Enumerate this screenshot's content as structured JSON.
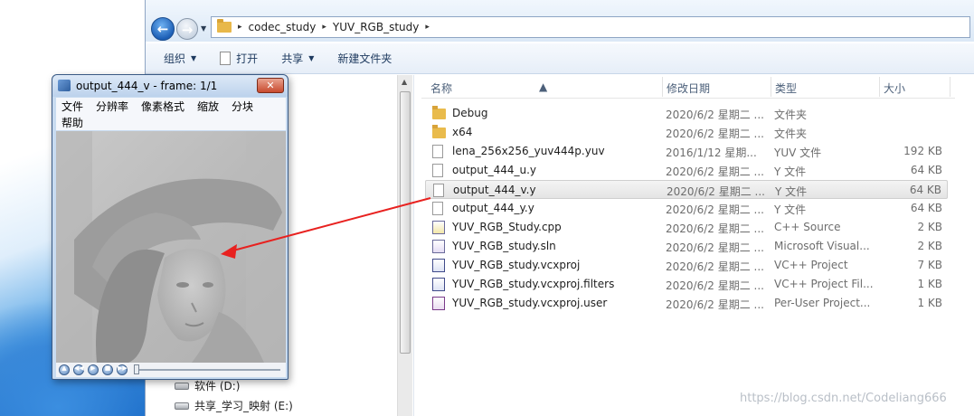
{
  "address": {
    "crumbs": [
      "codec_study",
      "YUV_RGB_study"
    ]
  },
  "toolbar": {
    "organize_label": "组织",
    "open_label": "打开",
    "share_label": "共享",
    "new_folder_label": "新建文件夹"
  },
  "leftpane": {
    "drives": [
      {
        "label": "软件 (D:)"
      },
      {
        "label": "共享_学习_映射 (E:)"
      }
    ]
  },
  "columns": {
    "name": "名称",
    "date": "修改日期",
    "type": "类型",
    "size": "大小"
  },
  "files": [
    {
      "name": "Debug",
      "date": "2020/6/2 星期二 ...",
      "type": "文件夹",
      "size": "",
      "icon": "folder-icon"
    },
    {
      "name": "x64",
      "date": "2020/6/2 星期二 ...",
      "type": "文件夹",
      "size": "",
      "icon": "folder-icon"
    },
    {
      "name": "lena_256x256_yuv444p.yuv",
      "date": "2016/1/12 星期...",
      "type": "YUV 文件",
      "size": "192 KB",
      "icon": "file-icon"
    },
    {
      "name": "output_444_u.y",
      "date": "2020/6/2 星期二 ...",
      "type": "Y 文件",
      "size": "64 KB",
      "icon": "file-icon"
    },
    {
      "name": "output_444_v.y",
      "date": "2020/6/2 星期二 ...",
      "type": "Y 文件",
      "size": "64 KB",
      "icon": "file-icon"
    },
    {
      "name": "output_444_y.y",
      "date": "2020/6/2 星期二 ...",
      "type": "Y 文件",
      "size": "64 KB",
      "icon": "file-icon"
    },
    {
      "name": "YUV_RGB_Study.cpp",
      "date": "2020/6/2 星期二 ...",
      "type": "C++ Source",
      "size": "2 KB",
      "icon": "cpp-file-icon"
    },
    {
      "name": "YUV_RGB_study.sln",
      "date": "2020/6/2 星期二 ...",
      "type": "Microsoft Visual...",
      "size": "2 KB",
      "icon": "solution-file-icon"
    },
    {
      "name": "YUV_RGB_study.vcxproj",
      "date": "2020/6/2 星期二 ...",
      "type": "VC++ Project",
      "size": "7 KB",
      "icon": "project-file-icon"
    },
    {
      "name": "YUV_RGB_study.vcxproj.filters",
      "date": "2020/6/2 星期二 ...",
      "type": "VC++ Project Fil...",
      "size": "1 KB",
      "icon": "project-file-icon"
    },
    {
      "name": "YUV_RGB_study.vcxproj.user",
      "date": "2020/6/2 星期二 ...",
      "type": "Per-User Project...",
      "size": "1 KB",
      "icon": "user-file-icon"
    }
  ],
  "selected_file_index": 4,
  "viewer": {
    "title": "output_444_v - frame: 1/1",
    "close_label": "✕",
    "menu": [
      "文件",
      "分辨率",
      "像素格式",
      "缩放",
      "分块",
      "帮助"
    ],
    "controls": [
      "eject-icon",
      "rewind-icon",
      "play-icon",
      "stop-icon",
      "fast-forward-icon"
    ]
  },
  "annotation_color": "#e8211f",
  "watermark": "https://blog.csdn.net/Codeliang666"
}
